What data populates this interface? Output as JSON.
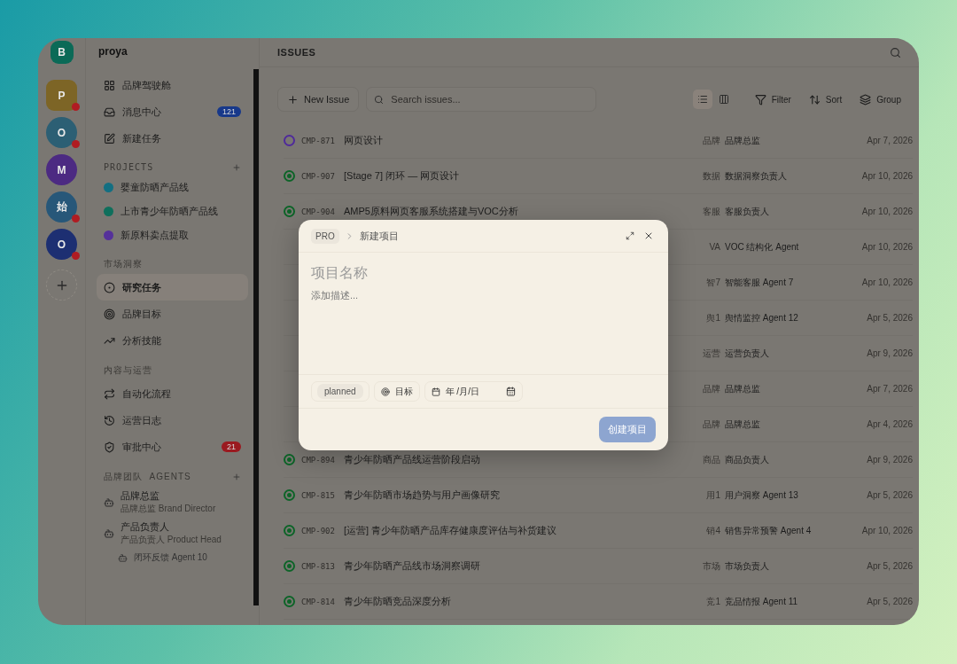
{
  "rail": {
    "current": {
      "letter": "B",
      "color": "#0b6a57"
    },
    "workspaces": [
      {
        "letter": "P",
        "color": "#7d6526",
        "kind": "square",
        "alert": true
      },
      {
        "letter": "O",
        "color": "#2c5f74",
        "kind": "circle",
        "alert": true
      },
      {
        "letter": "M",
        "color": "#4c2a82",
        "kind": "circle",
        "alert": false
      },
      {
        "letter": "始",
        "color": "#275779",
        "kind": "circle",
        "alert": true
      },
      {
        "letter": "O",
        "color": "#1d2f72",
        "kind": "circle",
        "alert": true
      }
    ]
  },
  "sidebar": {
    "title": "proya",
    "nav": [
      {
        "label": "品牌驾驶舱",
        "selected": false
      },
      {
        "label": "消息中心",
        "selected": false,
        "badge": {
          "text": "121",
          "color": "#17388a"
        }
      },
      {
        "label": "新建任务",
        "selected": false
      }
    ],
    "projects": {
      "heading": "PROJECTS",
      "items": [
        {
          "label": "婴童防晒产品线",
          "color": "#136f82"
        },
        {
          "label": "上市青少年防晒产品线",
          "color": "#0f6f5c"
        },
        {
          "label": "新原料卖点提取",
          "color": "#55319a"
        }
      ]
    },
    "sections": [
      {
        "heading": "市场洞察",
        "items": [
          {
            "label": "研究任务",
            "selected": true
          },
          {
            "label": "品牌目标",
            "selected": false
          },
          {
            "label": "分析技能",
            "selected": false
          }
        ]
      },
      {
        "heading": "内容与运营",
        "items": [
          {
            "label": "自动化流程",
            "selected": false
          },
          {
            "label": "运营日志",
            "selected": false
          },
          {
            "label": "审批中心",
            "selected": false,
            "badge": {
              "text": "21",
              "color": "#9a1a20"
            }
          }
        ]
      }
    ],
    "agents": {
      "heading": "品牌团队  AGENTS",
      "items": [
        {
          "name": "品牌总监",
          "subtitle": "品牌总监 Brand Director"
        },
        {
          "name": "产品负责人",
          "subtitle": "产品负责人 Product Head",
          "children": [
            {
              "name": "闭环反馈 Agent 10"
            }
          ]
        }
      ]
    }
  },
  "main": {
    "title": "ISSUES",
    "toolbar": {
      "new_button": "New Issue",
      "search": {
        "placeholder": "Search issues..."
      },
      "views": [
        {
          "kind": "list",
          "selected": true
        },
        {
          "kind": "board",
          "selected": false
        }
      ],
      "actions": [
        {
          "kind": "filter",
          "label": "Filter"
        },
        {
          "kind": "sort",
          "label": "Sort"
        },
        {
          "kind": "group",
          "label": "Group"
        }
      ]
    },
    "issues": [
      {
        "kind": "todo",
        "id": "CMP-871",
        "title": "网页设计",
        "tag": "品牌",
        "assignee": "品牌总监",
        "date": "Apr 7, 2026"
      },
      {
        "kind": "done",
        "id": "CMP-907",
        "title": "[Stage 7] 闭环 — 网页设计",
        "tag": "数据",
        "assignee": "数据洞察负责人",
        "date": "Apr 10, 2026"
      },
      {
        "kind": "done",
        "id": "CMP-904",
        "title": "AMP5原料网页客服系统搭建与VOC分析",
        "tag": "客服",
        "assignee": "客服负责人",
        "date": "Apr 10, 2026"
      },
      {
        "tag": "VA",
        "assignee": "VOC 结构化 Agent",
        "date": "Apr 10, 2026"
      },
      {
        "tag": "智7",
        "assignee": "智能客服 Agent 7",
        "date": "Apr 10, 2026"
      },
      {
        "tag": "舆1",
        "assignee": "舆情监控 Agent 12",
        "date": "Apr 5, 2026"
      },
      {
        "tag": "运营",
        "assignee": "运营负责人",
        "date": "Apr 9, 2026"
      },
      {
        "tag": "品牌",
        "assignee": "品牌总监",
        "date": "Apr 7, 2026"
      },
      {
        "tag": "品牌",
        "assignee": "品牌总监",
        "date": "Apr 4, 2026"
      },
      {
        "kind": "done",
        "id": "CMP-894",
        "title": "青少年防晒产品线运营阶段启动",
        "tag": "商品",
        "assignee": "商品负责人",
        "date": "Apr 9, 2026"
      },
      {
        "kind": "done",
        "id": "CMP-815",
        "title": "青少年防晒市场趋势与用户画像研究",
        "tag": "用1",
        "assignee": "用户洞察 Agent 13",
        "date": "Apr 5, 2026"
      },
      {
        "kind": "done",
        "id": "CMP-902",
        "title": "[运营] 青少年防晒产品库存健康度评估与补货建议",
        "tag": "销4",
        "assignee": "销售异常预警 Agent 4",
        "date": "Apr 10, 2026"
      },
      {
        "kind": "done",
        "id": "CMP-813",
        "title": "青少年防晒产品线市场洞察调研",
        "tag": "市场",
        "assignee": "市场负责人",
        "date": "Apr 5, 2026"
      },
      {
        "kind": "done",
        "id": "CMP-814",
        "title": "青少年防晒竞品深度分析",
        "tag": "竞1",
        "assignee": "竞品情报 Agent 11",
        "date": "Apr 5, 2026"
      }
    ]
  },
  "modal": {
    "breadcrumb": {
      "project": "PRO",
      "page": "新建项目"
    },
    "title_placeholder": "项目名称",
    "description_placeholder": "添加描述...",
    "status": "planned",
    "goal": "目标",
    "date_placeholder": "年 /月/日",
    "submit": {
      "label": "创建项目",
      "disabled": true
    }
  }
}
